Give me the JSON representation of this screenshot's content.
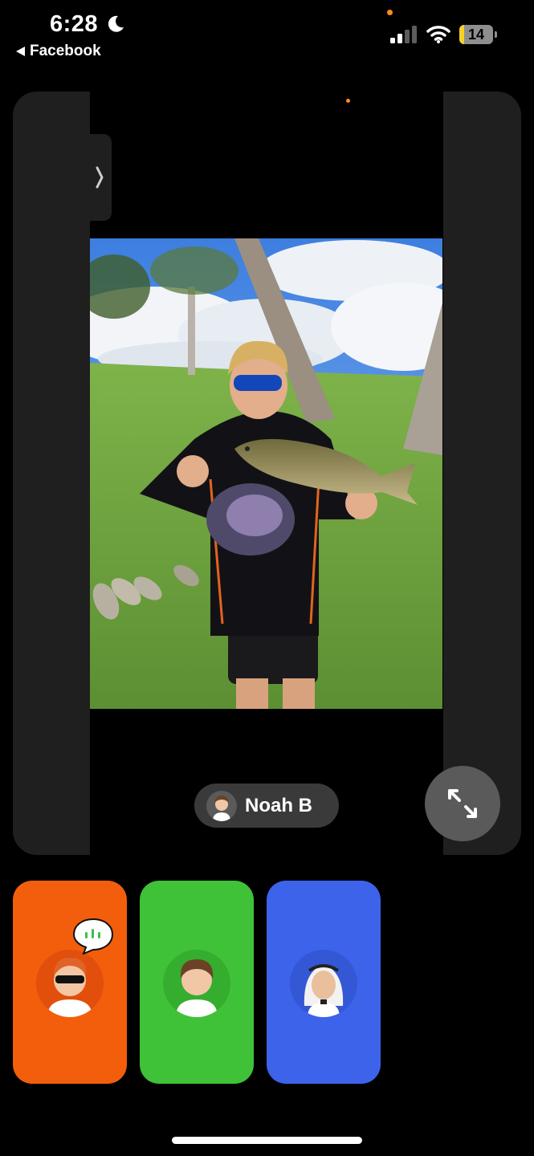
{
  "status_bar": {
    "time": "6:28",
    "back_label": "Facebook",
    "battery_level": "14",
    "battery_fraction": 0.14,
    "icons": [
      "moon-icon",
      "signal-icon",
      "wifi-icon",
      "battery-icon"
    ]
  },
  "call": {
    "active_speaker": "Noah B",
    "participants_count": 3,
    "participant_colors": [
      "#f35e0c",
      "#3fc237",
      "#3c63ea"
    ]
  },
  "icons": {
    "expand": "expand-arrows-icon",
    "side_handle": "chevron-right-icon",
    "speaking": "speaking-bubble-icon"
  }
}
